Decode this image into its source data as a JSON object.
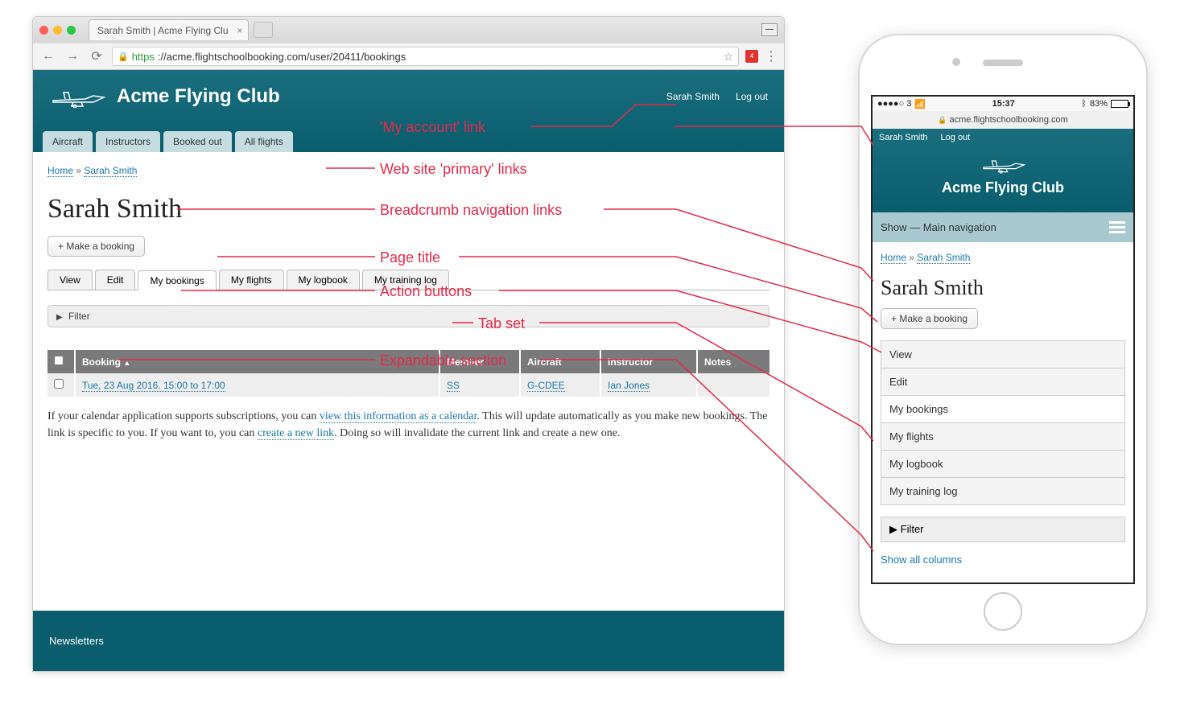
{
  "browser": {
    "tab_title": "Sarah Smith | Acme Flying Clu",
    "url_https": "https",
    "url_rest": "://acme.flightschoolbooking.com/user/20411/bookings",
    "ext_badge": "4"
  },
  "site": {
    "name": "Acme Flying Club",
    "account_user": "Sarah Smith",
    "logout": "Log out",
    "primary_nav": [
      "Aircraft",
      "Instructors",
      "Booked out",
      "All flights"
    ],
    "breadcrumb": {
      "home": "Home",
      "sep": "»",
      "current": "Sarah Smith"
    },
    "page_title": "Sarah Smith",
    "action_button": "+ Make a booking",
    "tabs": [
      "View",
      "Edit",
      "My bookings",
      "My flights",
      "My logbook",
      "My training log"
    ],
    "active_tab_index": 2,
    "filter_label": "Filter",
    "table": {
      "headers": [
        "",
        "Booking",
        "Member",
        "Aircraft",
        "Instructor",
        "Notes"
      ],
      "sort_col": 1,
      "rows": [
        {
          "booking": "Tue, 23 Aug 2016. 15:00 to 17:00",
          "member": "SS",
          "aircraft": "G-CDEE",
          "instructor": "Ian Jones",
          "notes": ""
        }
      ]
    },
    "calendar_note": {
      "p1a": "If your calendar application supports subscriptions, you can ",
      "link1": "view this information as a calendar",
      "p1b": ". This will update automatically as you make new bookings. The link is specific to you. If you want to, you can ",
      "link2": "create a new link",
      "p1c": ". Doing so will invalidate the current link and create a new one."
    },
    "footer_link": "Newsletters"
  },
  "annotations": {
    "my_account": "'My account' link",
    "primary_links": "Web site 'primary' links",
    "breadcrumb": "Breadcrumb navigation links",
    "page_title": "Page title",
    "action_buttons": "Action buttons",
    "tab_set": "Tab set",
    "expandable": "Expandable section"
  },
  "phone": {
    "status": {
      "carrier": "●●●●○ 3",
      "wifi": "≈",
      "time": "15:37",
      "bt": "⚢",
      "battery_pct": "83%"
    },
    "url_host": "acme.flightschoolbooking.com",
    "show_nav": "Show — Main navigation",
    "tabs": [
      "View",
      "Edit",
      "My bookings",
      "My flights",
      "My logbook",
      "My training log"
    ],
    "active_tab_index": 2,
    "show_all_cols": "Show all columns"
  }
}
